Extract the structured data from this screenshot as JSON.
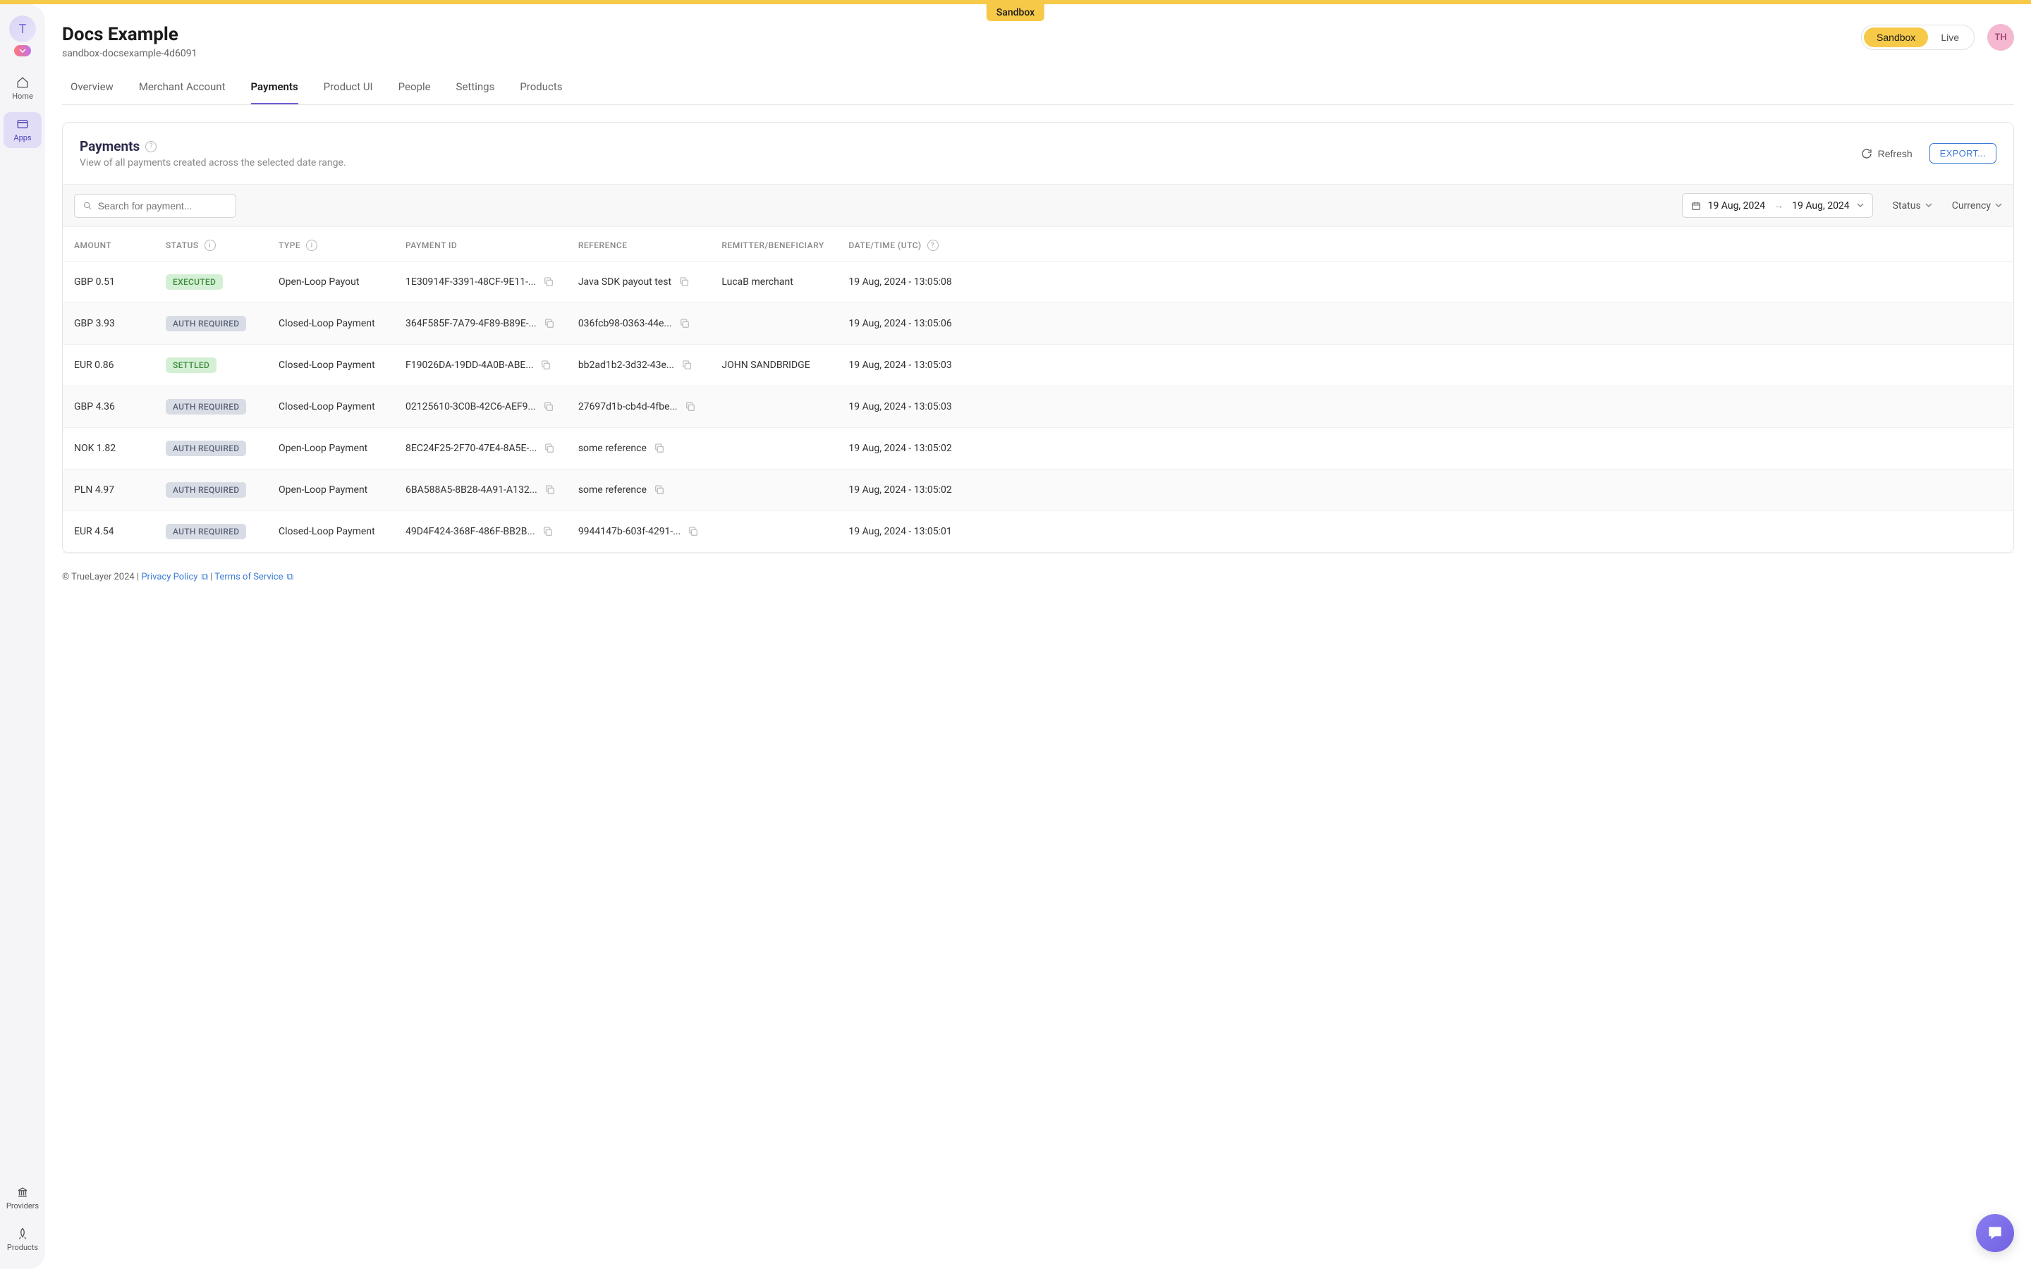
{
  "banner": {
    "label": "Sandbox"
  },
  "sidebar": {
    "avatar_letter": "T",
    "items": [
      {
        "label": "Home"
      },
      {
        "label": "Apps"
      }
    ],
    "bottom": [
      {
        "label": "Providers"
      },
      {
        "label": "Products"
      }
    ]
  },
  "header": {
    "title": "Docs Example",
    "subtitle": "sandbox-docsexample-4d6091",
    "env": {
      "sandbox": "Sandbox",
      "live": "Live"
    },
    "user_initials": "TH"
  },
  "tabs": [
    "Overview",
    "Merchant Account",
    "Payments",
    "Product UI",
    "People",
    "Settings",
    "Products"
  ],
  "active_tab": "Payments",
  "panel": {
    "title": "Payments",
    "description": "View of all payments created across the selected date range.",
    "refresh": "Refresh",
    "export": "EXPORT..."
  },
  "filters": {
    "search_placeholder": "Search for payment...",
    "date_from": "19 Aug, 2024",
    "date_to": "19 Aug, 2024",
    "status_label": "Status",
    "currency_label": "Currency"
  },
  "columns": {
    "amount": "AMOUNT",
    "status": "STATUS",
    "type": "TYPE",
    "payment_id": "PAYMENT ID",
    "reference": "REFERENCE",
    "remitter": "REMITTER/BENEFICIARY",
    "datetime": "DATE/TIME (UTC)"
  },
  "status_labels": {
    "executed": "EXECUTED",
    "auth": "AUTH REQUIRED",
    "settled": "SETTLED"
  },
  "rows": [
    {
      "amount": "GBP 0.51",
      "status": "executed",
      "type": "Open-Loop Payout",
      "pid": "1E30914F-3391-48CF-9E11-...",
      "ref": "Java SDK payout test",
      "remitter": "LucaB merchant",
      "dt": "19 Aug, 2024 - 13:05:08"
    },
    {
      "amount": "GBP 3.93",
      "status": "auth",
      "type": "Closed-Loop Payment",
      "pid": "364F585F-7A79-4F89-B89E-...",
      "ref": "036fcb98-0363-44e...",
      "remitter": "",
      "dt": "19 Aug, 2024 - 13:05:06"
    },
    {
      "amount": "EUR 0.86",
      "status": "settled",
      "type": "Closed-Loop Payment",
      "pid": "F19026DA-19DD-4A0B-ABE...",
      "ref": "bb2ad1b2-3d32-43e...",
      "remitter": "JOHN SANDBRIDGE",
      "dt": "19 Aug, 2024 - 13:05:03"
    },
    {
      "amount": "GBP 4.36",
      "status": "auth",
      "type": "Closed-Loop Payment",
      "pid": "02125610-3C0B-42C6-AEF9...",
      "ref": "27697d1b-cb4d-4fbe...",
      "remitter": "",
      "dt": "19 Aug, 2024 - 13:05:03"
    },
    {
      "amount": "NOK 1.82",
      "status": "auth",
      "type": "Open-Loop Payment",
      "pid": "8EC24F25-2F70-47E4-8A5E-...",
      "ref": "some reference",
      "remitter": "",
      "dt": "19 Aug, 2024 - 13:05:02"
    },
    {
      "amount": "PLN 4.97",
      "status": "auth",
      "type": "Open-Loop Payment",
      "pid": "6BA588A5-8B28-4A91-A132...",
      "ref": "some reference",
      "remitter": "",
      "dt": "19 Aug, 2024 - 13:05:02"
    },
    {
      "amount": "EUR 4.54",
      "status": "auth",
      "type": "Closed-Loop Payment",
      "pid": "49D4F424-368F-486F-BB2B...",
      "ref": "9944147b-603f-4291-...",
      "remitter": "",
      "dt": "19 Aug, 2024 - 13:05:01"
    }
  ],
  "footer": {
    "copyright": "© TrueLayer 2024",
    "privacy": "Privacy Policy",
    "terms": "Terms of Service",
    "sep": " | "
  }
}
